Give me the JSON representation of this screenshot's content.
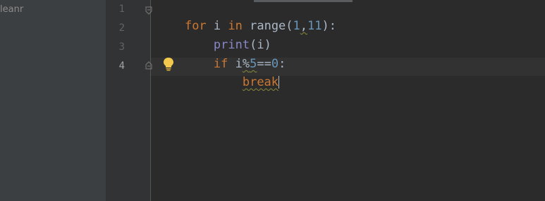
{
  "project": {
    "item_label": "leanr"
  },
  "gutter": {
    "line_numbers": [
      "1",
      "2",
      "3",
      "4"
    ]
  },
  "editor": {
    "lines": [
      {
        "indent": "",
        "tokens": [
          {
            "text": "for",
            "kind": "kw"
          },
          {
            "text": " i ",
            "kind": "plain"
          },
          {
            "text": "in",
            "kind": "kw"
          },
          {
            "text": " range(",
            "kind": "plain"
          },
          {
            "text": "1",
            "kind": "num"
          },
          {
            "text": ",",
            "kind": "plain"
          },
          {
            "text": "11",
            "kind": "num"
          },
          {
            "text": "):",
            "kind": "plain"
          }
        ]
      },
      {
        "indent": "    ",
        "tokens": [
          {
            "text": "print",
            "kind": "builtin"
          },
          {
            "text": "(i)",
            "kind": "plain"
          }
        ]
      },
      {
        "indent": "    ",
        "tokens": [
          {
            "text": "if",
            "kind": "kw"
          },
          {
            "text": " i",
            "kind": "plain"
          },
          {
            "text": "%",
            "kind": "plain"
          },
          {
            "text": "5",
            "kind": "num"
          },
          {
            "text": "==",
            "kind": "plain"
          },
          {
            "text": "0",
            "kind": "num"
          },
          {
            "text": ":",
            "kind": "plain"
          }
        ]
      },
      {
        "indent": "        ",
        "tokens": [
          {
            "text": "break",
            "kind": "kw"
          }
        ]
      }
    ]
  },
  "icons": {
    "fold_open": "fold-open-icon",
    "fold_end": "fold-end-icon",
    "intention": "lightbulb-icon"
  },
  "colors": {
    "keyword": "#cc7832",
    "number": "#6897bb",
    "builtin": "#8888c6",
    "text": "#a9b7c6",
    "background": "#2b2b2b",
    "bulb": "#f2c94c"
  }
}
